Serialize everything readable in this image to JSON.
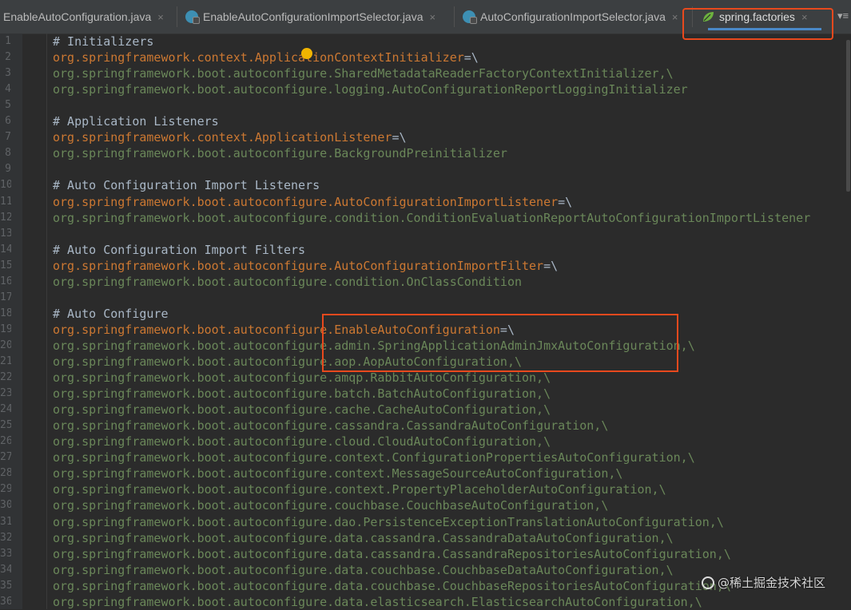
{
  "tabs": [
    {
      "label": "EnableAutoConfiguration.java",
      "icon": "java-class-icon",
      "active": false
    },
    {
      "label": "EnableAutoConfigurationImportSelector.java",
      "icon": "java-class-icon",
      "active": false
    },
    {
      "label": "AutoConfigurationImportSelector.java",
      "icon": "java-class-icon",
      "active": false
    },
    {
      "label": "spring.factories",
      "icon": "spring-leaf-icon",
      "active": true
    }
  ],
  "tab_close_glyph": "×",
  "tab_menu_glyph": "▾≡",
  "accent_color": "#4a88c7",
  "highlight_color": "#e8491d",
  "lines": [
    {
      "n": "1",
      "parts": [
        {
          "t": "# Initializers",
          "c": "comment"
        }
      ]
    },
    {
      "n": "2",
      "parts": [
        {
          "t": "org.springframework.context.ApplicationContextInitializer",
          "c": "key"
        },
        {
          "t": "=\\",
          "c": "plain"
        }
      ]
    },
    {
      "n": "3",
      "parts": [
        {
          "t": "org.springframework.boot.autoconfigure.SharedMetadataReaderFactoryContextInitializer,\\",
          "c": "val"
        }
      ]
    },
    {
      "n": "4",
      "parts": [
        {
          "t": "org.springframework.boot.autoconfigure.logging.AutoConfigurationReportLoggingInitializer",
          "c": "val"
        }
      ]
    },
    {
      "n": "5",
      "parts": [
        {
          "t": "",
          "c": "plain"
        }
      ]
    },
    {
      "n": "6",
      "parts": [
        {
          "t": "# Application Listeners",
          "c": "comment"
        }
      ]
    },
    {
      "n": "7",
      "parts": [
        {
          "t": "org.springframework.context.ApplicationListener",
          "c": "key"
        },
        {
          "t": "=\\",
          "c": "plain"
        }
      ]
    },
    {
      "n": "8",
      "parts": [
        {
          "t": "org.springframework.boot.autoconfigure.BackgroundPreinitializer",
          "c": "val"
        }
      ]
    },
    {
      "n": "9",
      "parts": [
        {
          "t": "",
          "c": "plain"
        }
      ]
    },
    {
      "n": "10",
      "parts": [
        {
          "t": "# Auto Configuration Import Listeners",
          "c": "comment"
        }
      ]
    },
    {
      "n": "11",
      "parts": [
        {
          "t": "org.springframework.boot.autoconfigure.AutoConfigurationImportListener",
          "c": "key"
        },
        {
          "t": "=\\",
          "c": "plain"
        }
      ]
    },
    {
      "n": "12",
      "parts": [
        {
          "t": "org.springframework.boot.autoconfigure.condition.ConditionEvaluationReportAutoConfigurationImportListener",
          "c": "val"
        }
      ]
    },
    {
      "n": "13",
      "parts": [
        {
          "t": "",
          "c": "plain"
        }
      ]
    },
    {
      "n": "14",
      "parts": [
        {
          "t": "# Auto Configuration Import Filters",
          "c": "comment"
        }
      ]
    },
    {
      "n": "15",
      "parts": [
        {
          "t": "org.springframework.boot.autoconfigure.AutoConfigurationImportFilter",
          "c": "key"
        },
        {
          "t": "=\\",
          "c": "plain"
        }
      ]
    },
    {
      "n": "16",
      "parts": [
        {
          "t": "org.springframework.boot.autoconfigure.condition.OnClassCondition",
          "c": "val"
        }
      ]
    },
    {
      "n": "17",
      "parts": [
        {
          "t": "",
          "c": "plain"
        }
      ]
    },
    {
      "n": "18",
      "parts": [
        {
          "t": "# Auto Configure",
          "c": "comment"
        }
      ]
    },
    {
      "n": "19",
      "parts": [
        {
          "t": "org.springframework.boot.autoconfigure.EnableAutoConfiguration",
          "c": "key"
        },
        {
          "t": "=\\",
          "c": "plain"
        }
      ]
    },
    {
      "n": "20",
      "parts": [
        {
          "t": "org.springframework.boot.autoconfigure.admin.SpringApplicationAdminJmxAutoConfiguration,\\",
          "c": "val"
        }
      ]
    },
    {
      "n": "21",
      "parts": [
        {
          "t": "org.springframework.boot.autoconfigure.aop.AopAutoConfiguration,\\",
          "c": "val"
        }
      ]
    },
    {
      "n": "22",
      "parts": [
        {
          "t": "org.springframework.boot.autoconfigure.amqp.RabbitAutoConfiguration,\\",
          "c": "val"
        }
      ]
    },
    {
      "n": "23",
      "parts": [
        {
          "t": "org.springframework.boot.autoconfigure.batch.BatchAutoConfiguration,\\",
          "c": "val"
        }
      ]
    },
    {
      "n": "24",
      "parts": [
        {
          "t": "org.springframework.boot.autoconfigure.cache.CacheAutoConfiguration,\\",
          "c": "val"
        }
      ]
    },
    {
      "n": "25",
      "parts": [
        {
          "t": "org.springframework.boot.autoconfigure.cassandra.CassandraAutoConfiguration,\\",
          "c": "val"
        }
      ]
    },
    {
      "n": "26",
      "parts": [
        {
          "t": "org.springframework.boot.autoconfigure.cloud.CloudAutoConfiguration,\\",
          "c": "val"
        }
      ]
    },
    {
      "n": "27",
      "parts": [
        {
          "t": "org.springframework.boot.autoconfigure.context.ConfigurationPropertiesAutoConfiguration,\\",
          "c": "val"
        }
      ]
    },
    {
      "n": "28",
      "parts": [
        {
          "t": "org.springframework.boot.autoconfigure.context.MessageSourceAutoConfiguration,\\",
          "c": "val"
        }
      ]
    },
    {
      "n": "29",
      "parts": [
        {
          "t": "org.springframework.boot.autoconfigure.context.PropertyPlaceholderAutoConfiguration,\\",
          "c": "val"
        }
      ]
    },
    {
      "n": "30",
      "parts": [
        {
          "t": "org.springframework.boot.autoconfigure.couchbase.CouchbaseAutoConfiguration,\\",
          "c": "val"
        }
      ]
    },
    {
      "n": "31",
      "parts": [
        {
          "t": "org.springframework.boot.autoconfigure.dao.PersistenceExceptionTranslationAutoConfiguration,\\",
          "c": "val"
        }
      ]
    },
    {
      "n": "32",
      "parts": [
        {
          "t": "org.springframework.boot.autoconfigure.data.cassandra.CassandraDataAutoConfiguration,\\",
          "c": "val"
        }
      ]
    },
    {
      "n": "33",
      "parts": [
        {
          "t": "org.springframework.boot.autoconfigure.data.cassandra.CassandraRepositoriesAutoConfiguration,\\",
          "c": "val"
        }
      ]
    },
    {
      "n": "34",
      "parts": [
        {
          "t": "org.springframework.boot.autoconfigure.data.couchbase.CouchbaseDataAutoConfiguration,\\",
          "c": "val"
        }
      ]
    },
    {
      "n": "35",
      "parts": [
        {
          "t": "org.springframework.boot.autoconfigure.data.couchbase.CouchbaseRepositoriesAutoConfiguration,\\",
          "c": "val"
        }
      ]
    },
    {
      "n": "36",
      "parts": [
        {
          "t": "org.springframework.boot.autoconfigure.data.elasticsearch.ElasticsearchAutoConfiguration,\\",
          "c": "val"
        }
      ]
    }
  ],
  "watermark": "@稀土掘金技术社区"
}
